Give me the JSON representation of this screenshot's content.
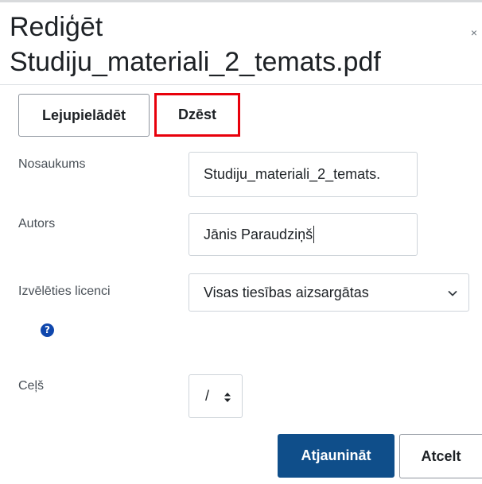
{
  "dialog": {
    "title_line1": "Rediģēt",
    "title_line2": "Studiju_materiali_2_temats.pdf",
    "close_symbol": "×"
  },
  "actions": {
    "download_label": "Lejupielādēt",
    "delete_label": "Dzēst",
    "highlight_color": "#e8000b"
  },
  "form": {
    "name_label": "Nosaukums",
    "name_value": "Studiju_materiali_2_temats.",
    "author_label": "Autors",
    "author_value": "Jānis Paraudziņš",
    "license_label": "Izvēlēties licenci",
    "license_value": "Visas tiesības aizsargātas",
    "help_symbol": "?",
    "path_label": "Ceļš",
    "path_value": "/"
  },
  "footer": {
    "update_label": "Atjaunināt",
    "cancel_label": "Atcelt",
    "primary_color": "#0f4e8a"
  },
  "icons": {
    "close": "close-icon",
    "help": "question-circle-icon",
    "chevron": "chevron-down-icon",
    "updown": "sort-updown-icon"
  }
}
